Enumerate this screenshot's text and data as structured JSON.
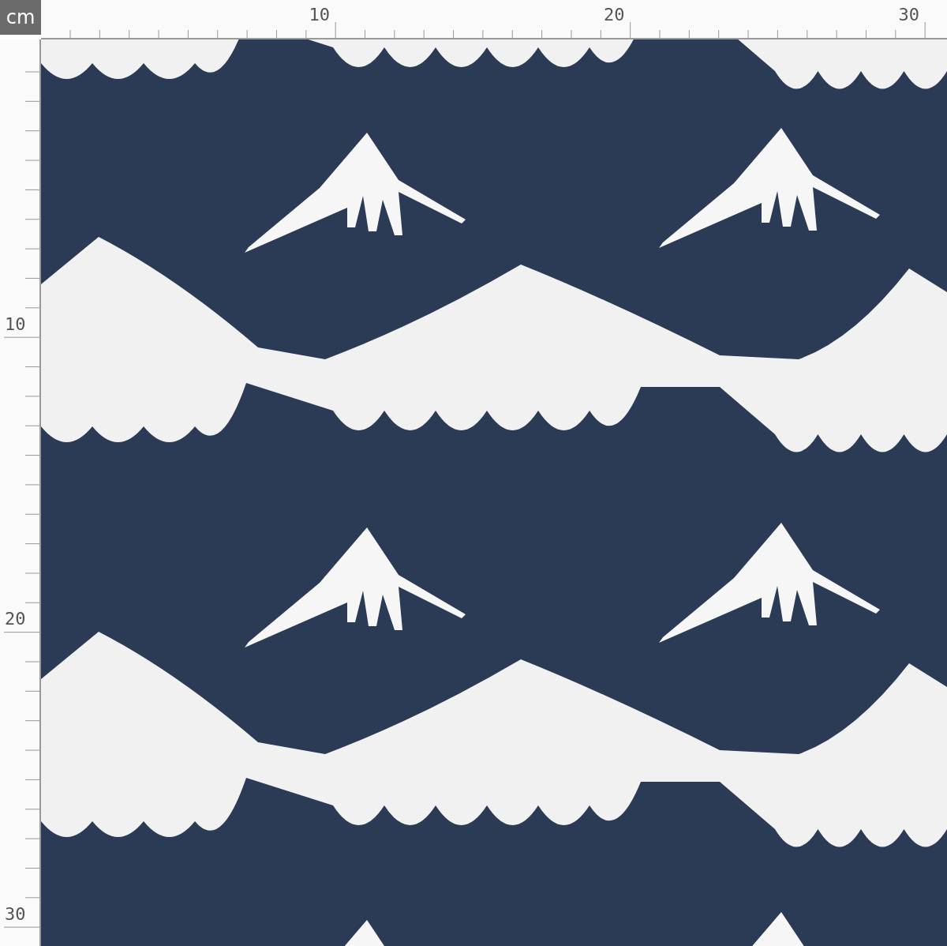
{
  "unit_badge": "cm",
  "top_ruler": {
    "labels": [
      "10",
      "20",
      "30"
    ]
  },
  "left_ruler": {
    "labels": [
      "10",
      "20",
      "30"
    ]
  }
}
